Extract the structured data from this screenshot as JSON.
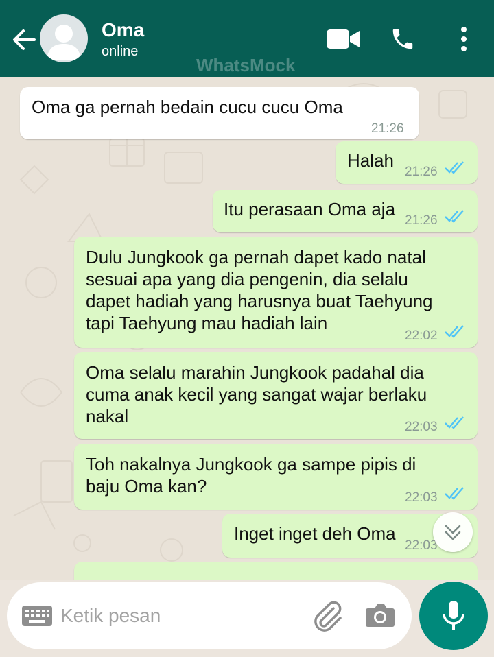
{
  "header": {
    "contact_name": "Oma",
    "status": "online",
    "watermark": "WhatsMock",
    "icons": [
      "back-arrow-icon",
      "video-call-icon",
      "voice-call-icon",
      "more-options-icon"
    ]
  },
  "messages": [
    {
      "direction": "incoming",
      "text": "Oma ga pernah bedain cucu cucu Oma",
      "time": "21:26"
    },
    {
      "direction": "outgoing",
      "text": "Halah",
      "time": "21:26",
      "read": true
    },
    {
      "direction": "outgoing",
      "text": "Itu perasaan Oma aja",
      "time": "21:26",
      "read": true
    },
    {
      "direction": "outgoing",
      "text": "Dulu Jungkook ga pernah dapet kado natal\nsesuai apa yang dia pengenin, dia selalu\ndapet hadiah yang harusnya buat Taehyung\ntapi Taehyung mau hadiah lain",
      "time": "22:02",
      "read": true
    },
    {
      "direction": "outgoing",
      "text": "Oma selalu marahin Jungkook padahal dia\ncuma anak kecil yang sangat wajar berlaku\nnakal",
      "time": "22:03",
      "read": true
    },
    {
      "direction": "outgoing",
      "text": "Toh nakalnya Jungkook ga sampe pipis di\nbaju Oma kan?",
      "time": "22:03",
      "read": true
    },
    {
      "direction": "outgoing",
      "text": "Inget inget deh Oma",
      "time": "22:03",
      "read": true
    }
  ],
  "input": {
    "placeholder": "Ketik pesan",
    "icons": [
      "keyboard-icon",
      "attach-icon",
      "camera-icon",
      "mic-icon"
    ]
  },
  "colors": {
    "header": "#075e54",
    "outgoing_bubble": "#dcf8c6",
    "incoming_bubble": "#ffffff",
    "read_ticks": "#4fc3f7",
    "mic_button": "#00897b"
  }
}
